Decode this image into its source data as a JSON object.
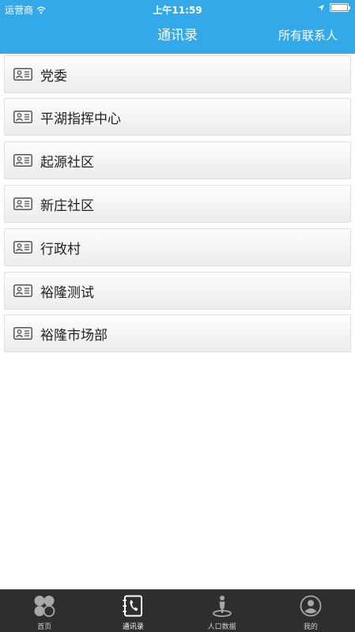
{
  "status_bar": {
    "carrier": "运营商",
    "time": "上午11:59"
  },
  "header": {
    "title": "通讯录",
    "right_action": "所有联系人"
  },
  "contacts": [
    {
      "label": "党委"
    },
    {
      "label": "平湖指挥中心"
    },
    {
      "label": "起源社区"
    },
    {
      "label": "新庄社区"
    },
    {
      "label": "行政村"
    },
    {
      "label": "裕隆测试"
    },
    {
      "label": "裕隆市场部"
    }
  ],
  "tabs": [
    {
      "label": "首页",
      "icon": "home-icon"
    },
    {
      "label": "通讯录",
      "icon": "contacts-icon"
    },
    {
      "label": "人口数据",
      "icon": "population-icon"
    },
    {
      "label": "我的",
      "icon": "profile-icon"
    }
  ],
  "colors": {
    "accent": "#33a9ea",
    "tab_bar": "#2e2e2e"
  }
}
